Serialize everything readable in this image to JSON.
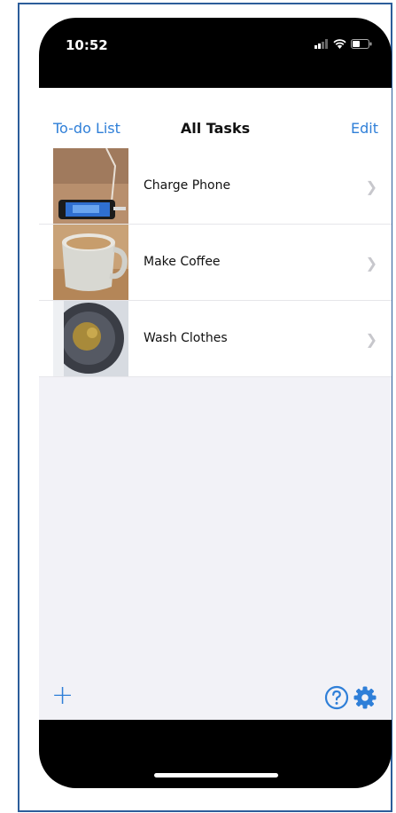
{
  "status_bar": {
    "time": "10:52"
  },
  "nav": {
    "back_label": "To-do List",
    "title": "All Tasks",
    "edit_label": "Edit"
  },
  "tasks": [
    {
      "label": "Charge Phone",
      "thumbnail": "phone-charging-photo"
    },
    {
      "label": "Make Coffee",
      "thumbnail": "coffee-mug-photo"
    },
    {
      "label": "Wash Clothes",
      "thumbnail": "washing-machine-drum-photo"
    }
  ],
  "toolbar": {
    "add_icon": "plus-icon",
    "help_icon": "question-circle-icon",
    "settings_icon": "gear-icon"
  },
  "colors": {
    "accent": "#2f7fd8",
    "background": "#f2f2f7",
    "separator": "#e6e6ea"
  }
}
